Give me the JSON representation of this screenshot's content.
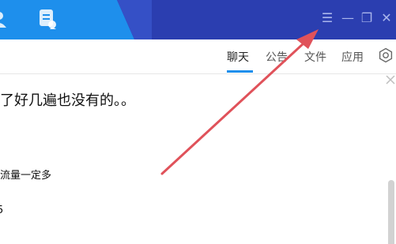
{
  "window": {
    "controls": {
      "menu_glyph": "☰",
      "minimize_glyph": "—",
      "restore_glyph": "❐",
      "close_glyph": "✕"
    },
    "colors": {
      "title_bar_dark": "#2b3eb0",
      "title_bar_light": "#1e8fec",
      "accent": "#1e8fec",
      "annotation_arrow": "#e0525a"
    },
    "icons": [
      "contacts-icon",
      "notes-icon",
      "menu-icon",
      "minimize-icon",
      "restore-icon",
      "close-icon",
      "settings-icon"
    ]
  },
  "tabs": [
    {
      "label": "聊天",
      "active": true
    },
    {
      "label": "公告",
      "active": false
    },
    {
      "label": "文件",
      "active": false
    },
    {
      "label": "应用",
      "active": false
    }
  ],
  "messages": [
    {
      "text": "了好几遍也没有的。。"
    },
    {
      "text": "流量一定多"
    },
    {
      "text": "5"
    }
  ]
}
